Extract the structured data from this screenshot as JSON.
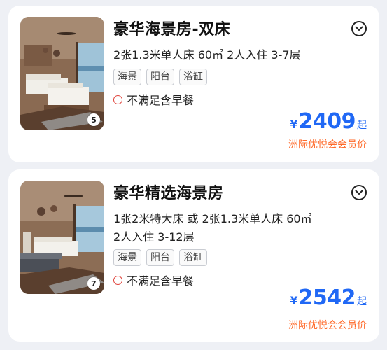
{
  "rooms": [
    {
      "title": "豪华海景房-双床",
      "spec_lines": [
        "2张1.3米单人床 60㎡ 2人入住 3-7层"
      ],
      "tags": [
        "海景",
        "阳台",
        "浴缸"
      ],
      "breakfast_note": "不满足含早餐",
      "photo_count": "5",
      "currency": "¥",
      "price": "2409",
      "price_suffix": "起",
      "member_label": "洲际优悦会会员价"
    },
    {
      "title": "豪华精选海景房",
      "spec_lines": [
        "1张2米特大床 或 2张1.3米单人床 60㎡",
        "2人入住 3-12层"
      ],
      "tags": [
        "海景",
        "阳台",
        "浴缸"
      ],
      "breakfast_note": "不满足含早餐",
      "photo_count": "7",
      "currency": "¥",
      "price": "2542",
      "price_suffix": "起",
      "member_label": "洲际优悦会会员价"
    }
  ],
  "colors": {
    "price": "#2068f5",
    "member": "#ff6a2a",
    "warning": "#e0423a",
    "background": "#eef0f5"
  },
  "icons": {
    "expand": "chevron-down-circle-icon",
    "warning": "exclamation-circle-icon"
  }
}
